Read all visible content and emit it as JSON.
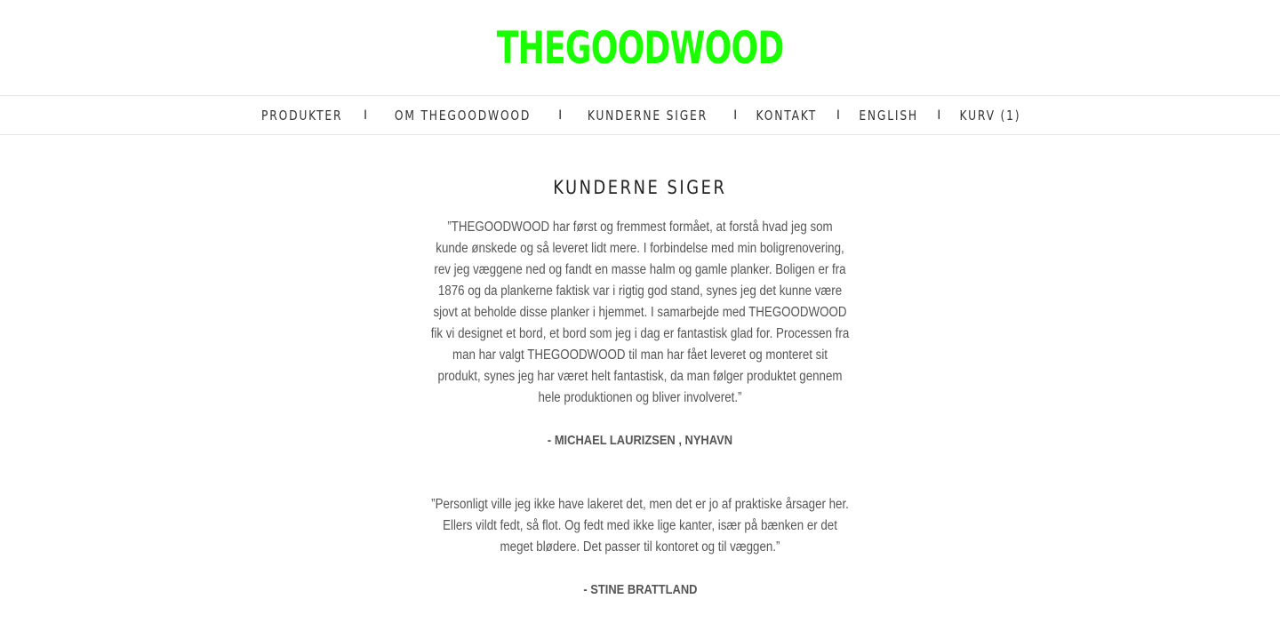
{
  "brand": {
    "logo_text": "THEGOODWOOD",
    "logo_color": "#1aff00"
  },
  "nav": {
    "items": [
      {
        "label": "PRODUKTER"
      },
      {
        "label": "OM THEGOODWOOD"
      },
      {
        "label": "KUNDERNE SIGER"
      },
      {
        "label": "KONTAKT"
      },
      {
        "label": "ENGLISH"
      },
      {
        "label": "KURV (1)"
      }
    ],
    "separator": "I"
  },
  "page": {
    "title": "KUNDERNE SIGER"
  },
  "testimonials": [
    {
      "quote": "”THEGOODWOOD har først og fremmest formået, at forstå hvad jeg som kunde ønskede og så leveret lidt mere. I forbindelse med min boligrenovering, rev jeg væggene ned og fandt en masse halm og gamle planker. Boligen er fra 1876 og da plankerne faktisk var i rigtig god stand, synes jeg det kunne være sjovt at beholde disse planker i hjemmet. I samarbejde med THEGOODWOOD fik vi designet et bord, et bord som jeg i dag er fantastisk glad for. Processen fra man har valgt THEGOODWOOD til man har fået leveret og monteret sit produkt, synes jeg har været helt fantastisk, da man følger produktet gennem hele produktionen og bliver involveret.”",
      "author": "- MICHAEL LAURIZSEN , NYHAVN"
    },
    {
      "quote": "”Personligt ville jeg ikke have lakeret det, men det er jo af praktiske årsager her. Ellers vildt fedt, så flot. Og fedt med ikke lige kanter, især på bænken er det meget blødere. Det passer til kontoret og til væggen.”",
      "author": "- STINE BRATTLAND"
    }
  ]
}
